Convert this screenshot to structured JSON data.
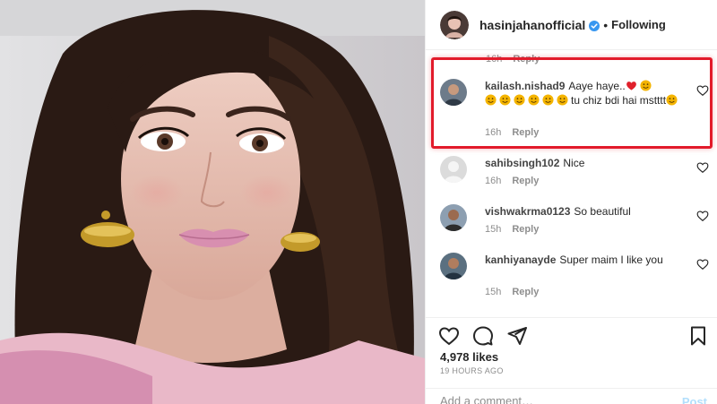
{
  "post": {
    "image_alt_icon": "portrait-photo"
  },
  "header": {
    "username": "hasinjahanofficial",
    "separator": "•",
    "follow_status": "Following",
    "verified_color": "#3897f0"
  },
  "comments": {
    "fragment": {
      "time": "16h",
      "reply_label": "Reply"
    },
    "items": [
      {
        "username": "kailash.nishad9",
        "text_before_emoji": "Aaye haye..",
        "text_middle": "tu chiz bdi hai mstttt",
        "time": "16h",
        "reply_label": "Reply",
        "highlighted": true
      },
      {
        "username": "sahibsingh102",
        "text": "Nice",
        "time": "16h",
        "reply_label": "Reply"
      },
      {
        "username": "vishwakrma0123",
        "text": "So beautiful",
        "time": "15h",
        "reply_label": "Reply"
      },
      {
        "username": "kanhiyanayde",
        "text": "Super maim I like you",
        "time": "15h",
        "reply_label": "Reply"
      }
    ]
  },
  "actions": {
    "likes": "4,978 likes",
    "timestamp": "19 HOURS AGO"
  },
  "add_comment": {
    "placeholder": "Add a comment…",
    "post_label": "Post"
  },
  "colors": {
    "highlight": "#e21b2b",
    "heart_emoji": "#e0202b",
    "emoji_face": "#f4b400"
  }
}
